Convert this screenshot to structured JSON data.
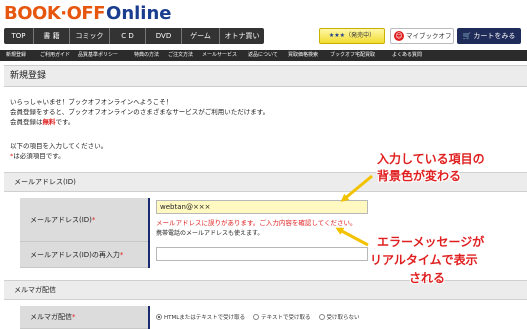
{
  "header": {
    "logo_book": "BOOK·OFF",
    "logo_online": "Online",
    "nav": [
      "TOP",
      "書 籍",
      "コミック",
      "C D",
      "DVD",
      "ゲーム",
      "オトナ買い"
    ],
    "kyaku_label": "（発売中）",
    "mybook_label": "マイブックオフ",
    "cart_label": "カートをみる"
  },
  "subnav": [
    "新規登録",
    "ご利用ガイド",
    "品質基準ポリシー",
    "特典の方法",
    "ご注文方法",
    "メールサービス",
    "返品について",
    "買取価格検索",
    "ブックオフ宅配買取",
    "よくある質問"
  ],
  "page_title": "新規登録",
  "intro": {
    "greeting": "いらっしゃいませ！ブックオフオンラインへようこそ！",
    "line2": "会員登録をすると、ブックオフオンラインのさまざまなサービスがご利用いただけます。",
    "line3_pre": "会員登録は",
    "line3_free": "無料",
    "line3_post": "です。",
    "line4": "以下の項目を入力してください。",
    "req_mark": "*",
    "line5": "は必須項目です。"
  },
  "mail_section": {
    "title": "メールアドレス(ID)",
    "field1_label": "メールアドレス(ID)",
    "field1_value": "webtan@×××",
    "error": "メールアドレスに誤りがあります。ご入力内容を確認してください。",
    "hint": "携帯電話のメールアドレスも使えます。",
    "field2_label": "メールアドレス(ID)の再入力",
    "req_mark": "*"
  },
  "magazine_section": {
    "title": "メルマガ配信",
    "field_label": "メルマガ配信",
    "req_mark": "*",
    "options": [
      "HTMLまたはテキストで受け取る",
      "テキストで受け取る",
      "受け取らない"
    ],
    "selected": 0
  },
  "annotations": {
    "a1_line1": "入力している項目の",
    "a1_line2": "背景色が変わる",
    "a2_line1": "エラーメッセージが",
    "a2_line2": "リアルタイムで表示",
    "a2_line3": "される"
  },
  "colors": {
    "brand_orange": "#e6560f",
    "brand_navy": "#1a3d8f",
    "error_red": "#e02020",
    "focus_bg": "#fff8c0"
  }
}
